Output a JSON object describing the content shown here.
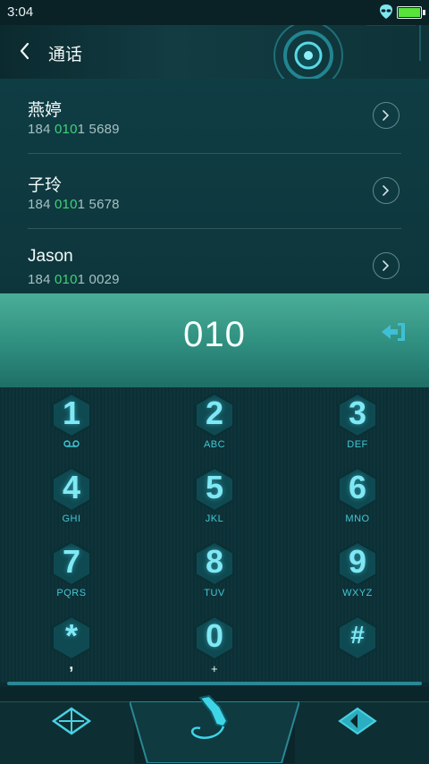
{
  "status": {
    "time": "3:04"
  },
  "header": {
    "title": "通话"
  },
  "contacts": [
    {
      "name": "燕婷",
      "num_pre": "184 ",
      "num_hl": "010",
      "num_post": "1 5689"
    },
    {
      "name": "子玲",
      "num_pre": "184 ",
      "num_hl": "010",
      "num_post": "1 5678"
    },
    {
      "name": "Jason",
      "num_pre": "184 ",
      "num_hl": "010",
      "num_post": "1 0029"
    }
  ],
  "display": {
    "number": "010"
  },
  "keys": [
    {
      "digit": "1",
      "sub": ""
    },
    {
      "digit": "2",
      "sub": "ABC"
    },
    {
      "digit": "3",
      "sub": "DEF"
    },
    {
      "digit": "4",
      "sub": "GHI"
    },
    {
      "digit": "5",
      "sub": "JKL"
    },
    {
      "digit": "6",
      "sub": "MNO"
    },
    {
      "digit": "7",
      "sub": "PQRS"
    },
    {
      "digit": "8",
      "sub": "TUV"
    },
    {
      "digit": "9",
      "sub": "WXYZ"
    },
    {
      "digit": "*",
      "sub": ","
    },
    {
      "digit": "0",
      "sub": "+"
    },
    {
      "digit": "#",
      "sub": ""
    }
  ],
  "icons": {
    "status": [
      "alien-icon",
      "battery-icon"
    ],
    "header": [
      "back-chevron-icon"
    ],
    "row": [
      "chevron-right-icon"
    ],
    "display": [
      "backspace-icon"
    ],
    "key1": [
      "voicemail-icon"
    ],
    "bottombar": [
      "keypad-toggle-icon",
      "phone-handset-icon",
      "diamond-arrow-icon"
    ]
  },
  "colors": {
    "accent": "#4aae98",
    "highlight": "#3fd27a",
    "keyDigit": "#7fe8f4"
  }
}
